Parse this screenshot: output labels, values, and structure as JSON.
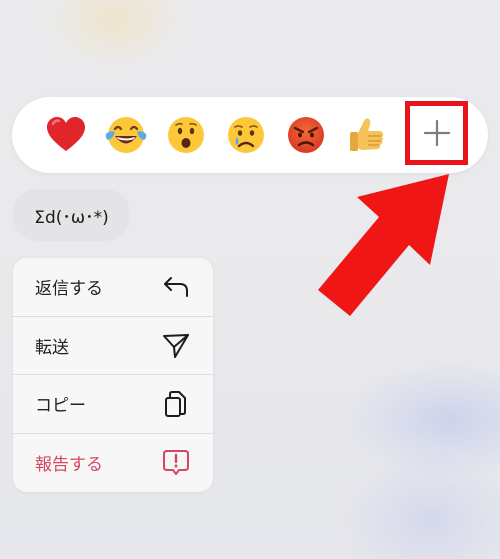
{
  "reactions": [
    {
      "icon": "red-heart-icon",
      "name": "heart"
    },
    {
      "icon": "tears-of-joy-icon",
      "name": "laugh"
    },
    {
      "icon": "surprised-face-icon",
      "name": "surprised"
    },
    {
      "icon": "crying-face-icon",
      "name": "sad"
    },
    {
      "icon": "angry-face-icon",
      "name": "angry"
    },
    {
      "icon": "thumbs-up-icon",
      "name": "thumbs-up"
    }
  ],
  "add_reaction": {
    "icon": "plus-icon"
  },
  "message": {
    "text": "Σd(･ω･*)"
  },
  "menu": {
    "items": [
      {
        "label": "返信する",
        "icon": "reply-icon"
      },
      {
        "label": "転送",
        "icon": "send-icon"
      },
      {
        "label": "コピー",
        "icon": "copy-icon"
      },
      {
        "label": "報告する",
        "icon": "report-icon"
      }
    ]
  },
  "colors": {
    "highlight": "#e8141c",
    "danger": "#d8475f",
    "bubble": "#e4e4e6",
    "menu_bg": "#f7f7f8"
  }
}
